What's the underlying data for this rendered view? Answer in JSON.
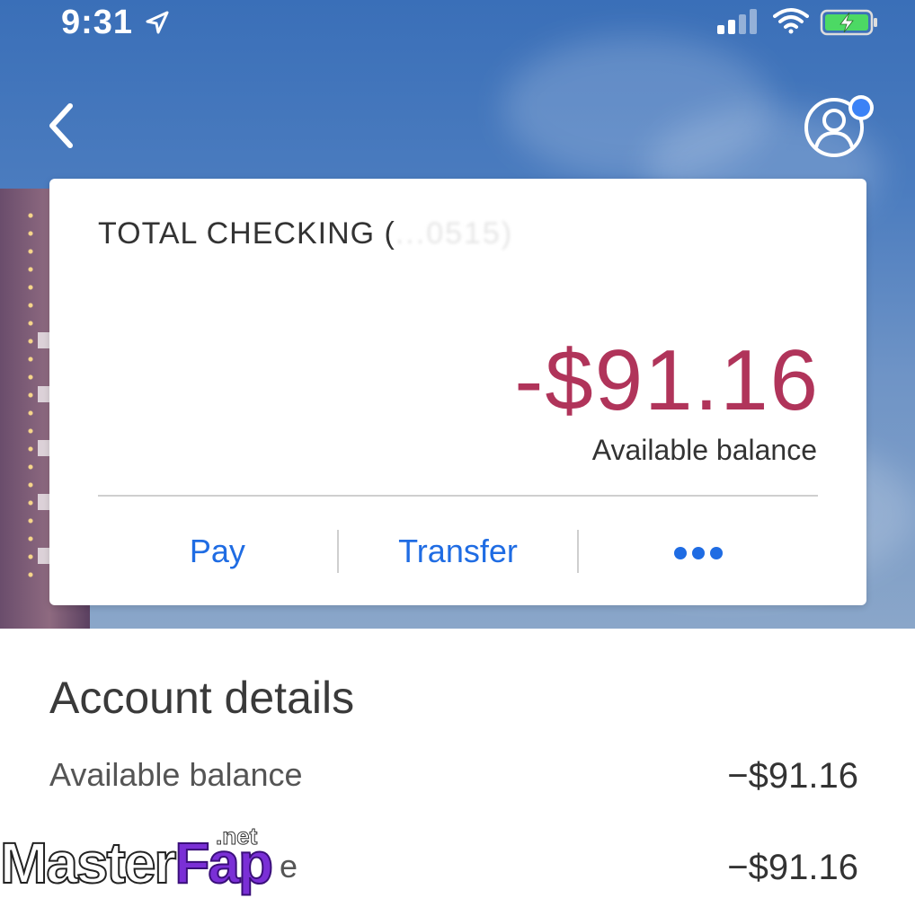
{
  "status_bar": {
    "time": "9:31",
    "icons": [
      "location-arrow-icon",
      "cellular-signal-icon",
      "wifi-icon",
      "battery-charging-icon"
    ]
  },
  "nav": {
    "back_icon": "chevron-left-icon",
    "profile_icon": "profile-icon",
    "profile_has_notification": true
  },
  "account_card": {
    "name": "TOTAL CHECKING (",
    "masked_number": "...0515",
    "name_suffix": ")",
    "balance": "-$91.16",
    "balance_label": "Available balance",
    "actions": {
      "pay": "Pay",
      "transfer": "Transfer",
      "more_icon": "more-dots-icon"
    }
  },
  "account_details": {
    "title": "Account details",
    "rows": [
      {
        "label": "Available balance",
        "value": "−$91.16"
      },
      {
        "label": "e",
        "value": "−$91.16"
      }
    ]
  },
  "watermark": {
    "master": "Master",
    "fap": "Fap",
    "net": ".net"
  },
  "colors": {
    "accent_blue": "#1f6ce3",
    "balance_red": "#b0345a",
    "notification_dot": "#3b82f6",
    "battery_green": "#4cd964"
  }
}
